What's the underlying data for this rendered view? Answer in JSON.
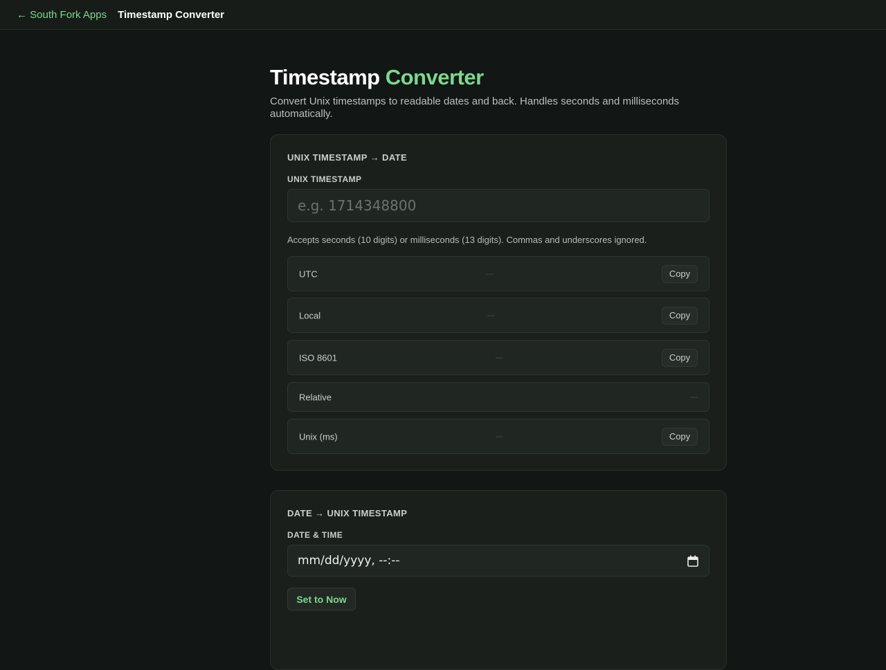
{
  "nav": {
    "back_label": "← South Fork Apps",
    "title": "Timestamp Converter"
  },
  "page": {
    "title_main": "Timestamp",
    "title_accent": "Converter",
    "subtitle": "Convert Unix timestamps to readable dates and back. Handles seconds and milliseconds automatically."
  },
  "unix_to_date": {
    "heading": "UNIX TIMESTAMP → DATE",
    "field_label": "UNIX TIMESTAMP",
    "input_value": "",
    "input_placeholder": "e.g. 1714348800",
    "hint": "Accepts seconds (10 digits) or milliseconds (13 digits). Commas and underscores ignored.",
    "rows": [
      {
        "label": "UTC",
        "value": "—",
        "copy_label": "Copy"
      },
      {
        "label": "Local",
        "value": "—",
        "copy_label": "Copy"
      },
      {
        "label": "ISO 8601",
        "value": "—",
        "copy_label": "Copy"
      },
      {
        "label": "Relative",
        "value": "—"
      },
      {
        "label": "Unix (ms)",
        "value": "—",
        "copy_label": "Copy"
      }
    ]
  },
  "date_to_unix": {
    "heading": "DATE → UNIX TIMESTAMP",
    "field_label": "DATE & TIME",
    "date_value": "mm/dd/yyyy, --:--",
    "set_now_label": "Set to Now"
  },
  "colors": {
    "background": "#121614",
    "card": "#1a1f1c",
    "accent": "#7dd88e",
    "text": "#e8ebe9"
  }
}
